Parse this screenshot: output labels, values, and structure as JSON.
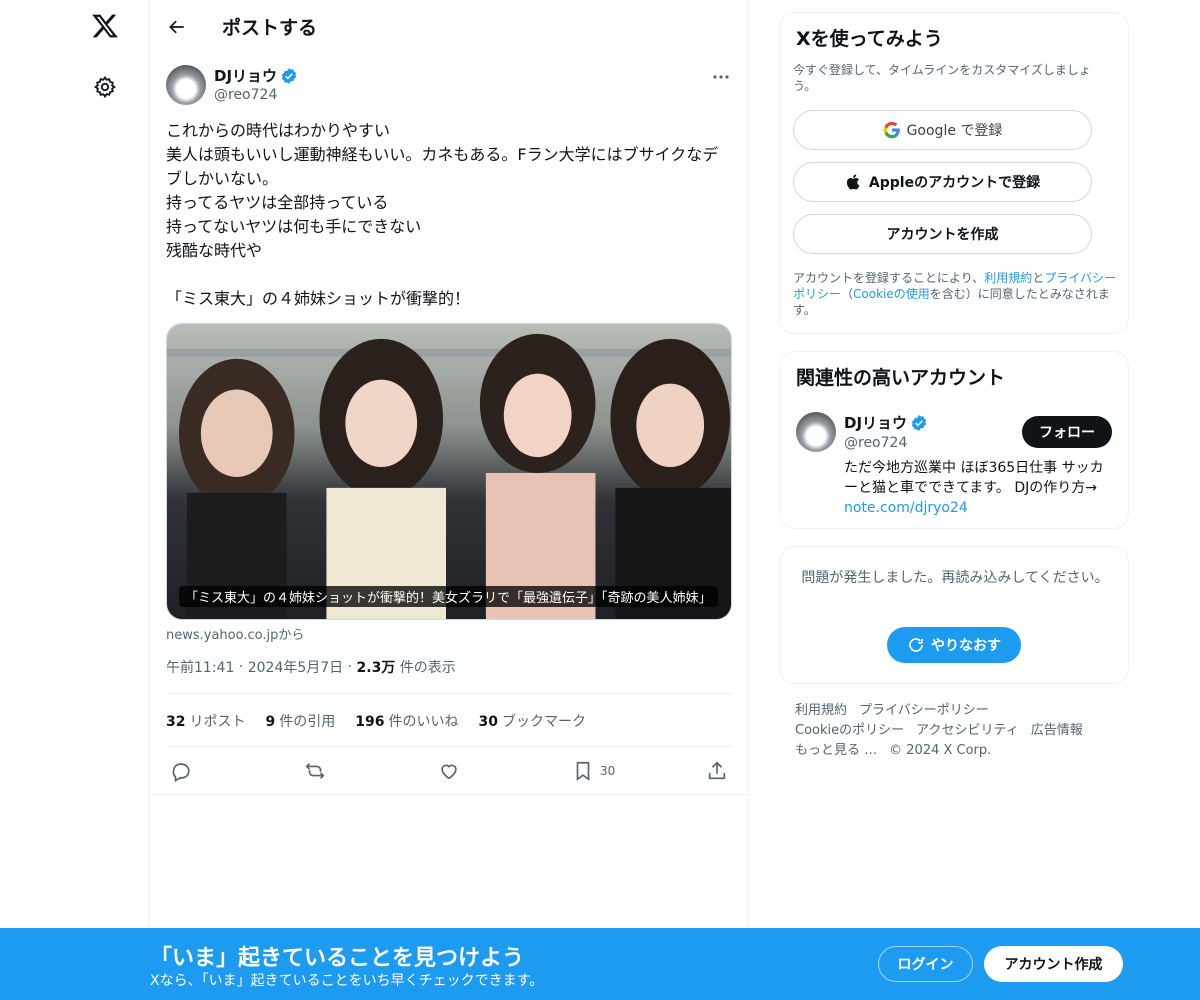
{
  "nav": {
    "logo_icon": "x-logo-icon",
    "settings_icon": "gear-icon"
  },
  "header": {
    "title": "ポストする"
  },
  "post": {
    "author_name": "DJリョウ",
    "author_handle": "@reo724",
    "text": "これからの時代はわかりやすい\n美人は頭もいいし運動神経もいい。カネもある。Fラン大学にはブサイクなデブしかいない。\n持ってるヤツは全部持っている\n持ってないヤツは何も手にできない\n残酷な時代や\n\n「ミス東大」の４姉妹ショットが衝撃的！",
    "card_caption": "「ミス東大」の４姉妹ショットが衝撃的！美女ズラリで「最強遺伝子」「奇跡の美人姉妹」",
    "card_source": "news.yahoo.co.jpから",
    "time": "午前11:41",
    "date": "2024年5月7日",
    "views_count": "2.3万",
    "views_label": "件の表示",
    "stats": [
      {
        "count": "32",
        "label": "リポスト"
      },
      {
        "count": "9",
        "label": "件の引用"
      },
      {
        "count": "196",
        "label": "件のいいね"
      },
      {
        "count": "30",
        "label": "ブックマーク"
      }
    ],
    "bookmark_count": "30"
  },
  "signup_panel": {
    "title": "Xを使ってみよう",
    "subtitle": "今すぐ登録して、タイムラインをカスタマイズしましょう。",
    "google_label": "Google で登録",
    "apple_label": "Appleのアカウントで登録",
    "create_label": "アカウントを作成",
    "legal_1": "アカウントを登録することにより、",
    "legal_terms": "利用規約",
    "legal_and": "と",
    "legal_privacy": "プライバシーポリシー",
    "legal_2": "（",
    "legal_cookie": "Cookieの使用",
    "legal_3": "を含む）に同意したとみなされます。"
  },
  "related": {
    "title": "関連性の高いアカウント",
    "name": "DJリョウ",
    "handle": "@reo724",
    "follow_label": "フォロー",
    "bio": "ただ今地方巡業中 ほぼ365日仕事 サッカーと猫と車でできてます。 DJの作り方→ ",
    "bio_link": "note.com/djryo24"
  },
  "error_panel": {
    "message": "問題が発生しました。再読み込みしてください。",
    "retry_label": "やりなおす"
  },
  "footer": {
    "terms": "利用規約",
    "privacy": "プライバシーポリシー",
    "cookie": "Cookieのポリシー",
    "accessibility": "アクセシビリティ",
    "ads": "広告情報",
    "more": "もっと見る …",
    "copyright": "© 2024 X Corp."
  },
  "banner": {
    "title": "「いま」起きていることを見つけよう",
    "subtitle": "Xなら、「いま」起きていることをいち早くチェックできます。",
    "login_label": "ログイン",
    "signup_label": "アカウント作成"
  },
  "colors": {
    "accent": "#1d9bf0",
    "text": "#0f1419",
    "muted": "#536471",
    "border": "#eff3f4"
  }
}
